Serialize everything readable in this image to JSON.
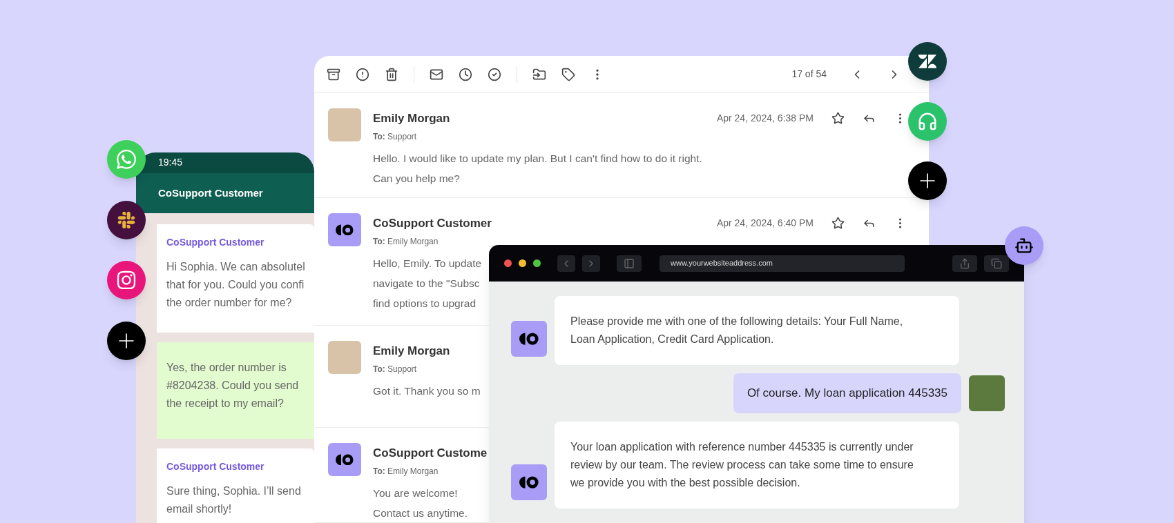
{
  "chat_app": {
    "time": "19:45",
    "title": "CoSupport Customer",
    "messages": [
      {
        "kind": "incoming",
        "sender": "CoSupport Customer",
        "lines": [
          "Hi Sophia. We can absolutel",
          "that for you. Could you confi",
          "the order number for me?"
        ]
      },
      {
        "kind": "outgoing",
        "lines": [
          "Yes, the order number is",
          "#8204238. Could you send",
          "the receipt to my email?"
        ]
      },
      {
        "kind": "incoming",
        "sender": "CoSupport Customer",
        "lines": [
          "Sure thing, Sophia. I’ll send",
          "email shortly!"
        ]
      }
    ]
  },
  "email": {
    "counter": "17 of 54",
    "messages": [
      {
        "kind": "photo",
        "sender": "Emily Morgan",
        "to": "**To:** Support",
        "date": "Apr 24, 2024, 6:38 PM",
        "body": [
          "Hello. I would like to update my plan. But I can't find how to do it right.",
          "Can you help me?"
        ]
      },
      {
        "kind": "logo",
        "sender": "CoSupport Customer",
        "to": "**To:** Emily Morgan",
        "date": "Apr 24, 2024, 6:40 PM",
        "body": [
          "Hello, Emily. To update",
          "navigate to the \"Subsc",
          "find options to upgrad"
        ]
      },
      {
        "kind": "photo",
        "sender": "Emily Morgan",
        "to": "**To:** Support",
        "body": [
          "Got it. Thank you so m"
        ]
      },
      {
        "kind": "logo",
        "sender": "CoSupport Custome",
        "to": "**To:** Emily Morgan",
        "body": [
          "You are welcome!",
          "Contact us anytime."
        ]
      }
    ]
  },
  "browser": {
    "url": "www.yourwebsiteaddress.com",
    "messages": [
      {
        "kind": "bot",
        "lines": [
          "Please provide me with one of the following details: Your Full Name,",
          "Loan Application, Credit Card Application."
        ]
      },
      {
        "kind": "user",
        "lines": [
          "Of course. My loan application 445335"
        ]
      },
      {
        "kind": "bot",
        "lines": [
          "Your loan application with reference number 445335 is currently under",
          "review by our team. The review process can take some time to ensure",
          "we provide you with the best possible decision."
        ]
      }
    ]
  }
}
